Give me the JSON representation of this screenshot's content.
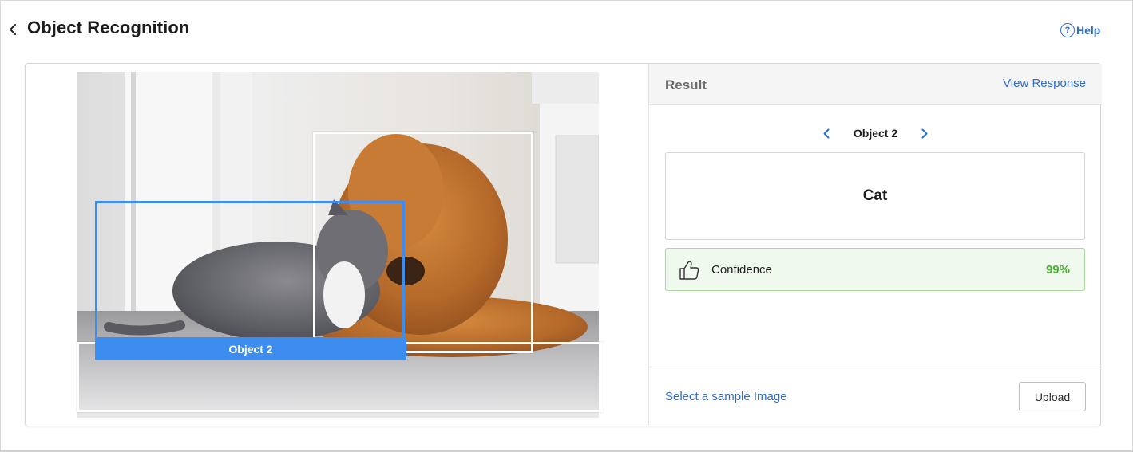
{
  "page": {
    "title": "Object Recognition",
    "help_label": "Help",
    "help_icon": "question-circle-icon",
    "back_icon": "chevron-left-icon"
  },
  "image": {
    "active_box_label": "Object 2",
    "box_color": "#3d8cf0"
  },
  "result": {
    "title": "Result",
    "view_response_label": "View Response",
    "current_object": "Object 2",
    "class_name": "Cat",
    "confidence_label": "Confidence",
    "confidence_value": "99%",
    "confidence_icon": "thumbs-up-icon",
    "confidence_color": "#4cae32"
  },
  "footer": {
    "sample_link_label": "Select a sample Image",
    "upload_label": "Upload"
  },
  "colors": {
    "link": "#2f6dc9",
    "accent": "#3d8cf0",
    "success": "#4cae32"
  }
}
